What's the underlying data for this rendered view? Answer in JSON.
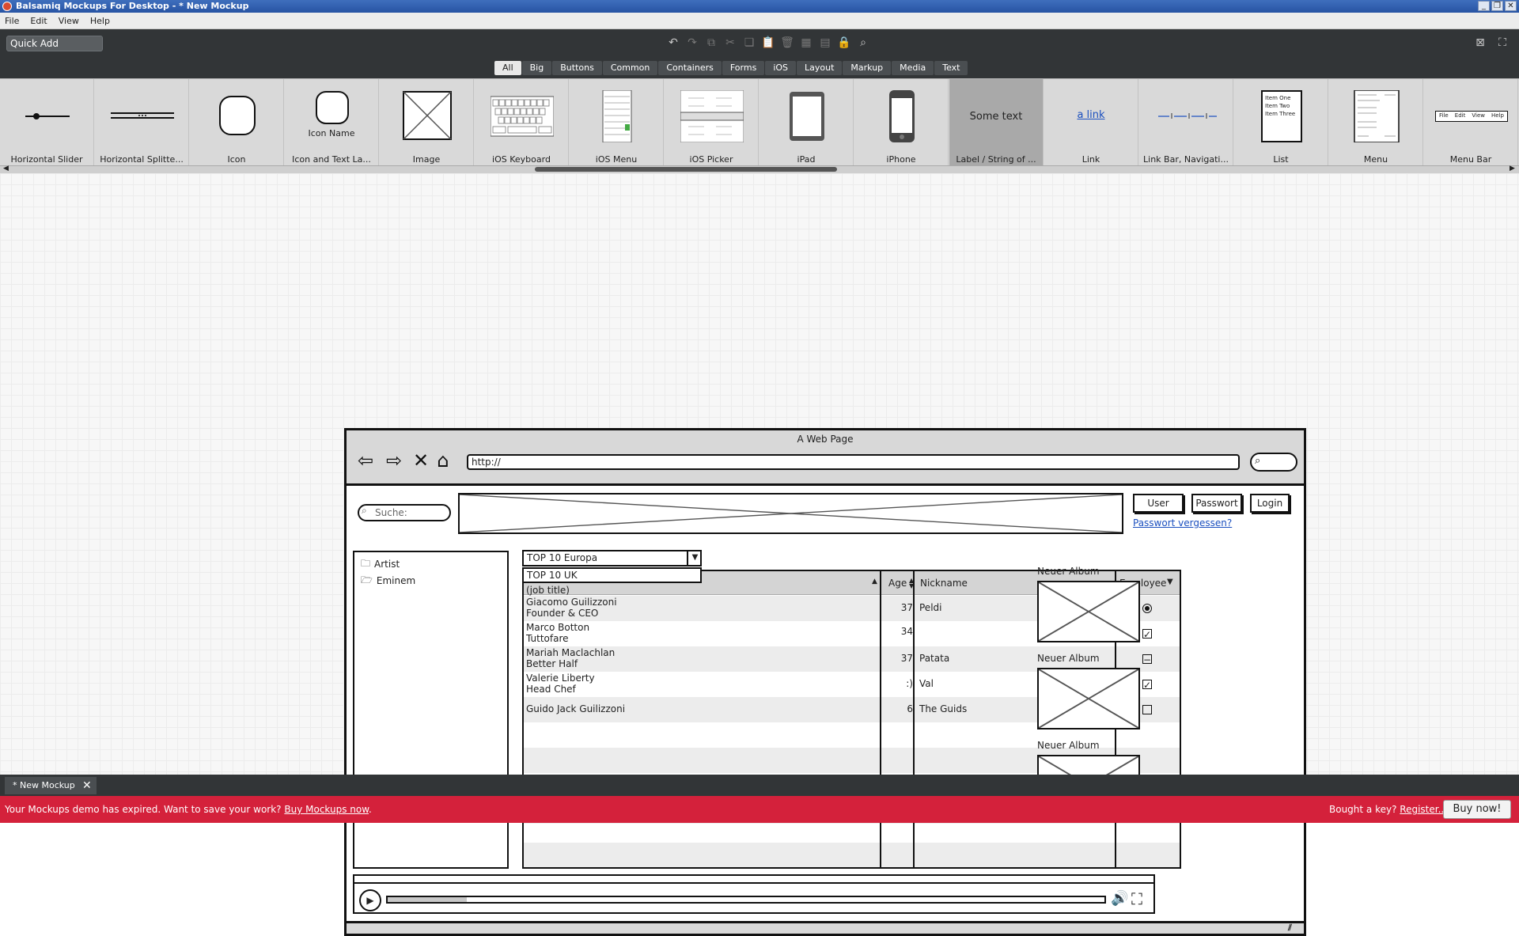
{
  "window": {
    "title": "Balsamiq Mockups For Desktop - * New Mockup"
  },
  "menubar": [
    "File",
    "Edit",
    "View",
    "Help"
  ],
  "toolbar": {
    "quick_add": "Quick Add"
  },
  "filters": [
    "All",
    "Big",
    "Buttons",
    "Common",
    "Containers",
    "Forms",
    "iOS",
    "Layout",
    "Markup",
    "Media",
    "Text"
  ],
  "library": [
    {
      "label": "Horizontal Slider",
      "icon": "slider-thumb"
    },
    {
      "label": "Horizontal Splitte...",
      "icon": "splitter-thumb"
    },
    {
      "label": "Icon",
      "icon": "icon-thumb"
    },
    {
      "label": "Icon and Text La...",
      "icon": "icon-text-thumb",
      "inner": "Icon Name"
    },
    {
      "label": "Image",
      "icon": "image-thumb"
    },
    {
      "label": "iOS Keyboard",
      "icon": "ios-keyboard-thumb"
    },
    {
      "label": "iOS Menu",
      "icon": "ios-menu-thumb"
    },
    {
      "label": "iOS Picker",
      "icon": "ios-picker-thumb"
    },
    {
      "label": "iPad",
      "icon": "ipad-thumb"
    },
    {
      "label": "iPhone",
      "icon": "iphone-thumb"
    },
    {
      "label": "Label / String of ...",
      "icon": "label-thumb",
      "inner": "Some text"
    },
    {
      "label": "Link",
      "icon": "link-thumb",
      "inner": "a link"
    },
    {
      "label": "Link Bar, Navigati...",
      "icon": "linkbar-thumb"
    },
    {
      "label": "List",
      "icon": "list-thumb",
      "inner_items": [
        "Item One",
        "Item Two",
        "Item Three"
      ]
    },
    {
      "label": "Menu",
      "icon": "menu-thumb"
    },
    {
      "label": "Menu Bar",
      "icon": "menubar-thumb",
      "inner_items": [
        "File",
        "Edit",
        "View",
        "Help"
      ]
    }
  ],
  "mockup": {
    "page_title": "A Web Page",
    "url": "http://",
    "search_placeholder": "Suche:",
    "login": {
      "user": "User",
      "password": "Passwort",
      "login": "Login",
      "forgot": "Passwort vergessen?"
    },
    "tree": [
      "Artist",
      "Eminem"
    ],
    "combo": {
      "selected": "TOP 10 Europa",
      "option": "TOP 10 UK"
    },
    "grid": {
      "headers": [
        "(job title)",
        "Age",
        "Nickname",
        "Employee"
      ],
      "rows": [
        {
          "name": "Giacomo Guilizzoni",
          "title": "Founder & CEO",
          "age": "37",
          "nick": "Peldi",
          "emp": "radio"
        },
        {
          "name": "Marco Botton",
          "title": "Tuttofare",
          "age": "34",
          "nick": "",
          "emp": "checked"
        },
        {
          "name": "Mariah Maclachlan",
          "title": "Better Half",
          "age": "37",
          "nick": "Patata",
          "emp": "mixed"
        },
        {
          "name": "Valerie Liberty",
          "title": "Head Chef",
          "age": ":)",
          "nick": "Val",
          "emp": "checked"
        },
        {
          "name": "Guido Jack Guilizzoni",
          "title": "",
          "age": "6",
          "nick": "The Guids",
          "emp": "unchecked"
        }
      ]
    },
    "albums": [
      "Neuer Album",
      "Neuer Album",
      "Neuer Album"
    ]
  },
  "doc_tab": "* New Mockup",
  "expiry": {
    "message": "Your Mockups demo has expired. Want to save your work?",
    "buy_link": "Buy Mockups now",
    "key_text": "Bought a key?",
    "register_link": "Register...",
    "buy_button": "Buy now!"
  }
}
